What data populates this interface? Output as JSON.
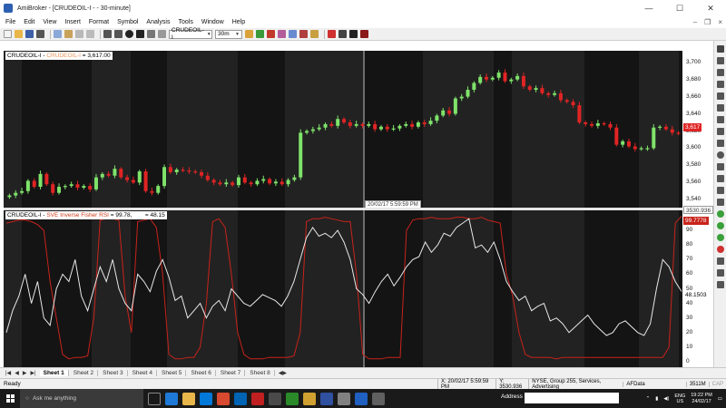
{
  "window": {
    "app_name": "AmiBroker",
    "title": "AmiBroker - [CRUDEOIL-I - - 30-minute]",
    "minimize": "—",
    "maximize": "☐",
    "close": "✕"
  },
  "menu": [
    "File",
    "Edit",
    "View",
    "Insert",
    "Format",
    "Symbol",
    "Analysis",
    "Tools",
    "Window",
    "Help"
  ],
  "toolbar": {
    "symbol": "CRUDEOIL-I",
    "interval": "30m"
  },
  "upper_pane": {
    "symbol": "CRUDEOIL-I",
    "sep": " - ",
    "indicator": "CRUDEOIL-I",
    "value": " = 3,617.00",
    "last_price": "3,617",
    "cursor_date": "20/02/17 5:59:59 PM",
    "axis_labels": [
      "3,700",
      "3,680",
      "3,660",
      "3,640",
      "3,620",
      "3,600",
      "3,580",
      "3,560",
      "3,540"
    ]
  },
  "lower_pane": {
    "symbol": "CRUDEOIL-I",
    "sep": " - ",
    "indicator": "SVE Inverse Fisher RSI",
    "value": " = 99.78,",
    "value2": "= 48.15",
    "red_tag": "99.7778",
    "white_tag": "48.1503",
    "cursor_tag": "3530.936",
    "axis_labels": [
      "90",
      "80",
      "70",
      "60",
      "50",
      "40",
      "30",
      "20",
      "10",
      "0"
    ]
  },
  "sheets": [
    "Sheet 1",
    "Sheet 2",
    "Sheet 3",
    "Sheet 4",
    "Sheet 5",
    "Sheet 6",
    "Sheet 7",
    "Sheet 8"
  ],
  "status": {
    "ready": "Ready",
    "x": "X: 20/02/17 5:59:59 PM",
    "y": "Y: 3530.936",
    "info": "NYSE, Group 255, Services, Advertising",
    "source": "AFData",
    "mem": "3511M",
    "cap": "CAP"
  },
  "taskbar": {
    "search_placeholder": "Ask me anything",
    "address_label": "Address",
    "lang": "ENG",
    "region": "US",
    "time": "19:22 PM",
    "date": "24/02/17"
  },
  "colors": {
    "bull": "#7fe36a",
    "bear": "#e02424",
    "rsi_red": "#c8231b",
    "rsi_white": "#e8e8e8",
    "chart_bg": "#141414"
  },
  "chart_data": [
    {
      "type": "candlestick",
      "symbol": "CRUDEOIL-I",
      "interval": "30-minute",
      "ylim": [
        3535,
        3705
      ],
      "yticks": [
        3540,
        3560,
        3580,
        3600,
        3620,
        3640,
        3660,
        3680,
        3700
      ],
      "last": 3617,
      "close": [
        3545,
        3548,
        3550,
        3562,
        3555,
        3570,
        3558,
        3548,
        3555,
        3556,
        3558,
        3554,
        3556,
        3552,
        3566,
        3570,
        3568,
        3576,
        3566,
        3563,
        3560,
        3573,
        3550,
        3548,
        3556,
        3578,
        3572,
        3575,
        3574,
        3573,
        3572,
        3568,
        3563,
        3560,
        3558,
        3560,
        3557,
        3566,
        3560,
        3558,
        3562,
        3564,
        3559,
        3561,
        3558,
        3563,
        3566,
        3618,
        3620,
        3622,
        3624,
        3628,
        3626,
        3634,
        3630,
        3626,
        3628,
        3626,
        3628,
        3622,
        3625,
        3622,
        3623,
        3626,
        3628,
        3625,
        3630,
        3628,
        3632,
        3638,
        3644,
        3640,
        3658,
        3660,
        3668,
        3676,
        3683,
        3680,
        3682,
        3688,
        3678,
        3680,
        3684,
        3672,
        3668,
        3670,
        3664,
        3662,
        3664,
        3656,
        3654,
        3650,
        3630,
        3628,
        3626,
        3629,
        3628,
        3624,
        3604,
        3608,
        3602,
        3599,
        3600,
        3600,
        3624,
        3625,
        3622,
        3618,
        3617
      ]
    },
    {
      "type": "line",
      "indicator": "SVE Inverse Fisher RSI",
      "ylim": [
        0,
        100
      ],
      "yticks": [
        0,
        10,
        20,
        30,
        40,
        50,
        60,
        70,
        80,
        90
      ],
      "series": [
        {
          "name": "SVE Inverse Fisher RSI",
          "values": [
            95,
            96,
            97,
            97,
            96,
            94,
            90,
            55,
            30,
            5,
            2,
            3,
            3,
            4,
            30,
            97,
            98,
            98,
            97,
            45,
            20,
            96,
            97,
            98,
            92,
            60,
            5,
            2,
            2,
            3,
            3,
            10,
            40,
            96,
            98,
            92,
            60,
            20,
            5,
            2,
            2,
            2,
            3,
            3,
            3,
            3,
            4,
            20,
            96,
            98,
            98,
            99,
            98,
            97,
            96,
            96,
            60,
            5,
            2,
            2,
            2,
            3,
            3,
            3,
            90,
            97,
            98,
            98,
            99,
            98,
            98,
            98,
            99,
            99,
            98,
            98,
            99,
            97,
            96,
            95,
            60,
            45,
            20,
            5,
            3,
            3,
            3,
            3,
            2,
            3,
            3,
            3,
            3,
            3,
            3,
            3,
            3,
            3,
            3,
            3,
            3,
            3,
            3,
            3,
            3,
            3,
            10,
            95,
            99.78
          ]
        },
        {
          "name": "RSI",
          "values": [
            20,
            35,
            45,
            60,
            40,
            55,
            30,
            25,
            50,
            60,
            55,
            70,
            45,
            35,
            50,
            65,
            55,
            70,
            50,
            40,
            35,
            60,
            55,
            48,
            62,
            70,
            58,
            42,
            45,
            30,
            35,
            40,
            30,
            38,
            42,
            35,
            50,
            45,
            40,
            38,
            42,
            46,
            44,
            42,
            38,
            45,
            55,
            70,
            85,
            92,
            86,
            88,
            85,
            90,
            82,
            70,
            50,
            46,
            40,
            48,
            55,
            60,
            52,
            58,
            65,
            70,
            72,
            82,
            75,
            80,
            88,
            86,
            92,
            95,
            98,
            78,
            80,
            75,
            82,
            70,
            55,
            48,
            42,
            45,
            35,
            38,
            40,
            28,
            30,
            26,
            20,
            24,
            28,
            32,
            26,
            22,
            18,
            20,
            26,
            28,
            24,
            20,
            18,
            26,
            50,
            70,
            65,
            55,
            48.15
          ]
        }
      ]
    }
  ]
}
